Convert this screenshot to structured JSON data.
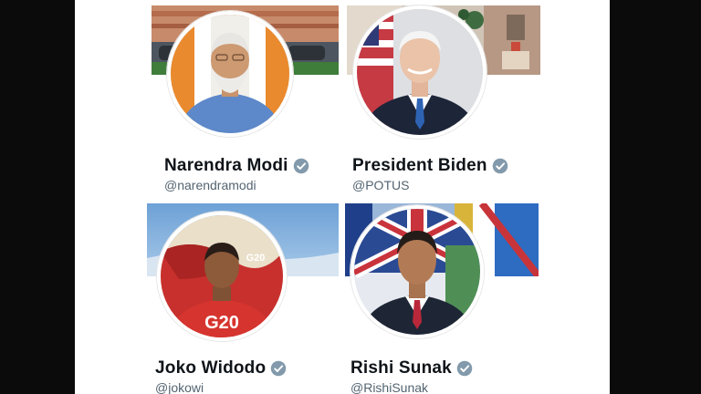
{
  "accounts": [
    {
      "name": "Narendra Modi",
      "handle": "@narendramodi",
      "verified_icon": "verified-badge-icon"
    },
    {
      "name": "President Biden",
      "handle": "@POTUS",
      "verified_icon": "verified-badge-icon"
    },
    {
      "name": "Joko Widodo",
      "handle": "@jokowi",
      "verified_icon": "verified-badge-icon"
    },
    {
      "name": "Rishi Sunak",
      "handle": "@RishiSunak",
      "verified_icon": "verified-badge-icon"
    }
  ],
  "colors": {
    "verified_badge": "#829aab",
    "name_text": "#0f1419",
    "handle_text": "#536471",
    "frame": "#0b0b0b"
  }
}
